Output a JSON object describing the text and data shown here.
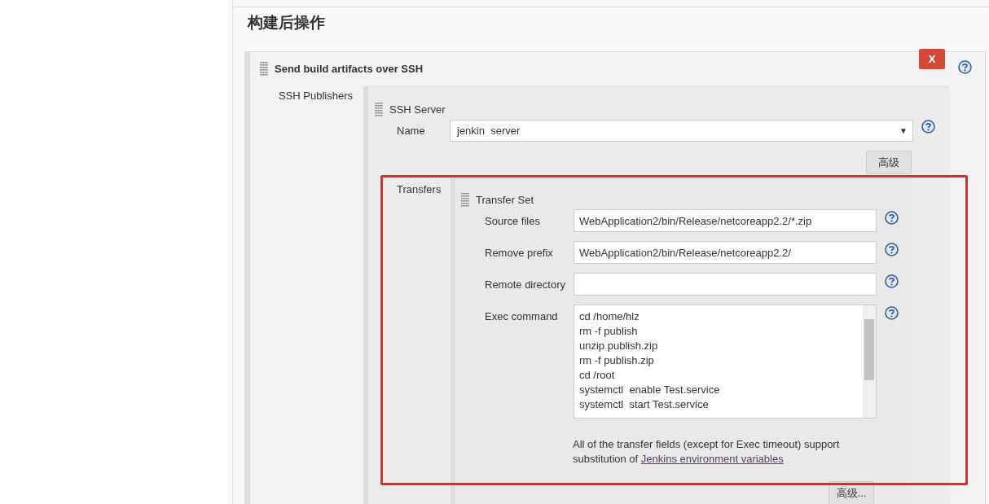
{
  "section": {
    "title": "构建后操作"
  },
  "step": {
    "title": "Send build artifacts over SSH",
    "delete_button": "X",
    "publishers_label": "SSH Publishers",
    "server": {
      "title": "SSH Server",
      "name_label": "Name",
      "name_value": "jenkin  server",
      "dropdown_arrow": "▼",
      "advanced_button": "高级",
      "transfers_label": "Transfers",
      "transfer_set": {
        "title": "Transfer Set",
        "fields": [
          {
            "label": "Source files",
            "value": "WebApplication2/bin/Release/netcoreapp2.2/*.zip"
          },
          {
            "label": "Remove prefix",
            "value": "WebApplication2/bin/Release/netcoreapp2.2/"
          },
          {
            "label": "Remote directory"
          }
        ],
        "exec_label": "Exec command",
        "exec_lines": [
          "cd /home/hlz",
          "rm -f publish",
          "unzip publish.zip",
          "rm -f publish.zip",
          "cd /root",
          "systemctl  enable Test.service",
          "systemctl  start Test.service"
        ],
        "note": "All of the transfer fields (except for Exec timeout) support substitution of ",
        "note_link": "Jenkins environment variables",
        "advanced_button": "高级..."
      }
    }
  }
}
